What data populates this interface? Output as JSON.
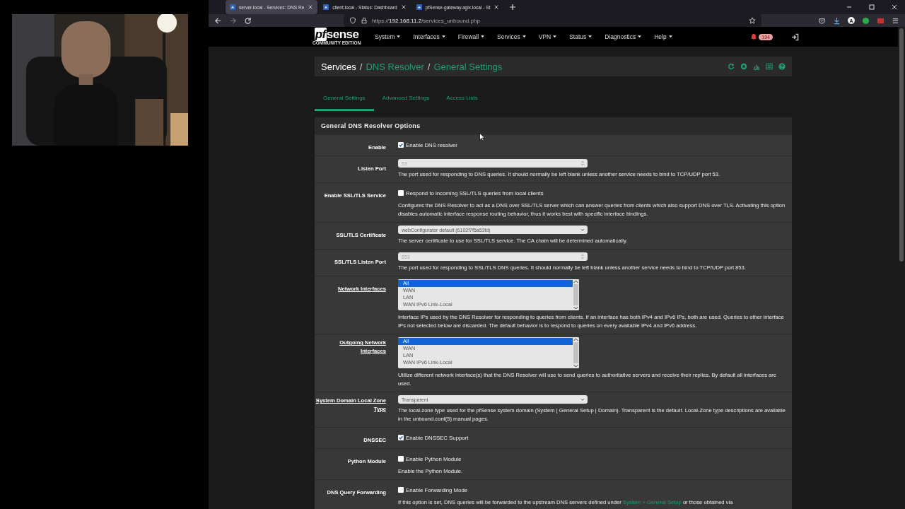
{
  "browser": {
    "tabs": [
      {
        "title": "server.local - Services: DNS Re",
        "selected": true
      },
      {
        "title": "client.local - Status: Dashboard",
        "selected": false
      },
      {
        "title": "pfSense-gateway.agix.local - St",
        "selected": false
      }
    ],
    "url_prefix": "https://",
    "url_host": "192.168.11.2",
    "url_path": "/services_unbound.php",
    "profile_initial": "A"
  },
  "webcam": {
    "kind": "picture"
  },
  "navbar": {
    "logo_prefix": "pf",
    "logo_main": "sense",
    "logo_sub": "COMMUNITY EDITION",
    "menus": [
      "System",
      "Interfaces",
      "Firewall",
      "Services",
      "VPN",
      "Status",
      "Diagnostics",
      "Help"
    ],
    "alert_count": "194"
  },
  "breadcrumb": [
    "Services",
    "DNS Resolver",
    "General Settings"
  ],
  "breadcrumb_separator": "/",
  "tabs": [
    {
      "label": "General Settings",
      "selected": true
    },
    {
      "label": "Advanced Settings",
      "selected": false
    },
    {
      "label": "Access Lists",
      "selected": false
    }
  ],
  "panel": {
    "title": "General DNS Resolver Options",
    "rows": [
      {
        "kind": "checkbox",
        "label": "Enable",
        "checked": true,
        "text": "Enable DNS resolver"
      },
      {
        "kind": "number",
        "label": "Listen Port",
        "placeholder": "53",
        "help": "The port used for responding to DNS queries. It should normally be left blank unless another service needs to bind to TCP/UDP port 53."
      },
      {
        "kind": "checkbox",
        "label": "Enable SSL/TLS Service",
        "checked": false,
        "text": "Respond to incoming SSL/TLS queries from local clients",
        "help": "Configures the DNS Resolver to act as a DNS over SSL/TLS server which can answer queries from clients which also support DNS over TLS. Activating this option disables automatic interface response routing behavior, thus it works best with specific interface bindings."
      },
      {
        "kind": "select",
        "label": "SSL/TLS Certificate",
        "value": "webConfigurator default (6102f7f5a53fd)",
        "help": "The server certificate to use for SSL/TLS service. The CA chain will be determined automatically."
      },
      {
        "kind": "number",
        "label": "SSL/TLS Listen Port",
        "placeholder": "853",
        "help": "The port used for responding to SSL/TLS DNS queries. It should normally be left blank unless another service needs to bind to TCP/UDP port 853."
      },
      {
        "kind": "listbox",
        "label": "Network Interfaces",
        "underlined": true,
        "options": [
          {
            "label": "All",
            "selected": true
          },
          {
            "label": "WAN",
            "selected": false
          },
          {
            "label": "LAN",
            "selected": false
          },
          {
            "label": "WAN IPv6 Link-Local",
            "selected": false
          }
        ],
        "help": "Interface IPs used by the DNS Resolver for responding to queries from clients. If an interface has both IPv4 and IPv6 IPs, both are used. Queries to other interface IPs not selected below are discarded. The default behavior is to respond to queries on every available IPv4 and IPv6 address."
      },
      {
        "kind": "listbox",
        "label": "Outgoing Network Interfaces",
        "underlined": true,
        "options": [
          {
            "label": "All",
            "selected": true
          },
          {
            "label": "WAN",
            "selected": false
          },
          {
            "label": "LAN",
            "selected": false
          },
          {
            "label": "WAN IPv6 Link-Local",
            "selected": false
          }
        ],
        "help": "Utilize different network interface(s) that the DNS Resolver will use to send queries to authoritative servers and receive their replies. By default all interfaces are used."
      },
      {
        "kind": "select",
        "label": "System Domain Local Zone Type",
        "underlined": true,
        "value": "Transparent",
        "help": "The local-zone type used for the pfSense system domain (System | General Setup | Domain). Transparent is the default. Local-Zone type descriptions are available in the unbound.conf(5) manual pages."
      },
      {
        "kind": "checkbox",
        "label": "DNSSEC",
        "checked": true,
        "text": "Enable DNSSEC Support"
      },
      {
        "kind": "checkbox",
        "label": "Python Module",
        "checked": false,
        "text": "Enable Python Module",
        "help": "Enable the Python Module."
      },
      {
        "kind": "checkbox",
        "label": "DNS Query Forwarding",
        "checked": false,
        "text": "Enable Forwarding Mode",
        "help": "If this option is set, DNS queries will be forwarded to the upstream DNS servers defined under ",
        "help_link": "System > General Setup",
        "help_after": " or those obtained via"
      }
    ]
  }
}
